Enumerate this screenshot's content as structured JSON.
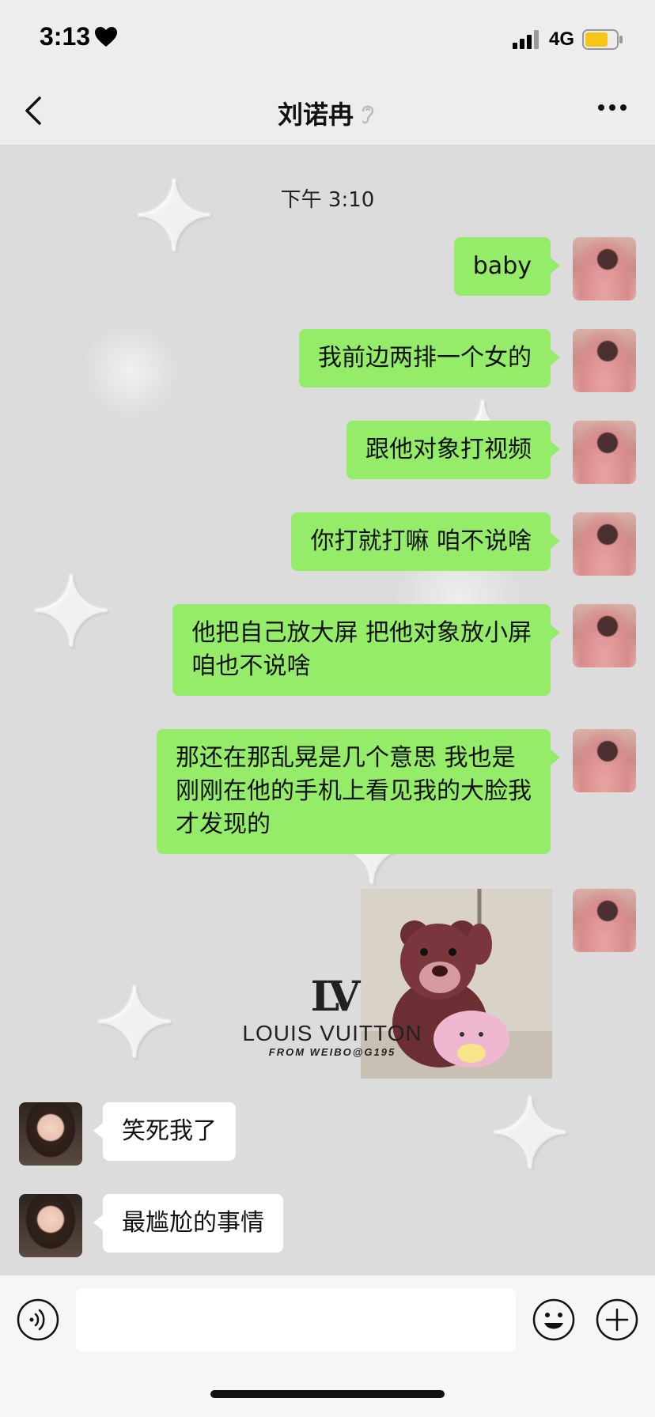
{
  "status_bar": {
    "time": "3:13",
    "network": "4G",
    "icons": [
      "heart-icon",
      "signal-icon",
      "battery-icon"
    ],
    "battery_color": "#f5c518"
  },
  "nav": {
    "title": "刘诺冉",
    "icons": [
      "back-icon",
      "ear-icon",
      "more-icon"
    ]
  },
  "chat": {
    "timestamp": "下午 3:10",
    "messages": [
      {
        "sender": "me",
        "type": "text",
        "text": "baby"
      },
      {
        "sender": "me",
        "type": "text",
        "text": "我前边两排一个女的"
      },
      {
        "sender": "me",
        "type": "text",
        "text": "跟他对象打视频"
      },
      {
        "sender": "me",
        "type": "text",
        "text": "你打就打嘛 咱不说啥"
      },
      {
        "sender": "me",
        "type": "text",
        "lines": [
          "他把自己放大屏 把他对象放小屏",
          "咱也不说啥"
        ]
      },
      {
        "sender": "me",
        "type": "text",
        "lines": [
          "那还在那乱晃是几个意思 我也是",
          "刚刚在他的手机上看见我的大脸我",
          "才发现的"
        ]
      },
      {
        "sender": "me",
        "type": "sticker",
        "sticker": "bear-sticker"
      },
      {
        "sender": "other",
        "type": "text",
        "text": "笑死我了"
      },
      {
        "sender": "other",
        "type": "text",
        "text": "最尴尬的事情"
      }
    ],
    "colors": {
      "my_bubble": "#95ec69",
      "other_bubble": "#ffffff"
    }
  },
  "watermark": {
    "logo": "LV",
    "brand": "LOUIS VUITTON",
    "sub": "FROM WEIBO@G195"
  },
  "input_bar": {
    "placeholder": "",
    "icons": [
      "voice-icon",
      "emoji-icon",
      "plus-icon"
    ]
  }
}
